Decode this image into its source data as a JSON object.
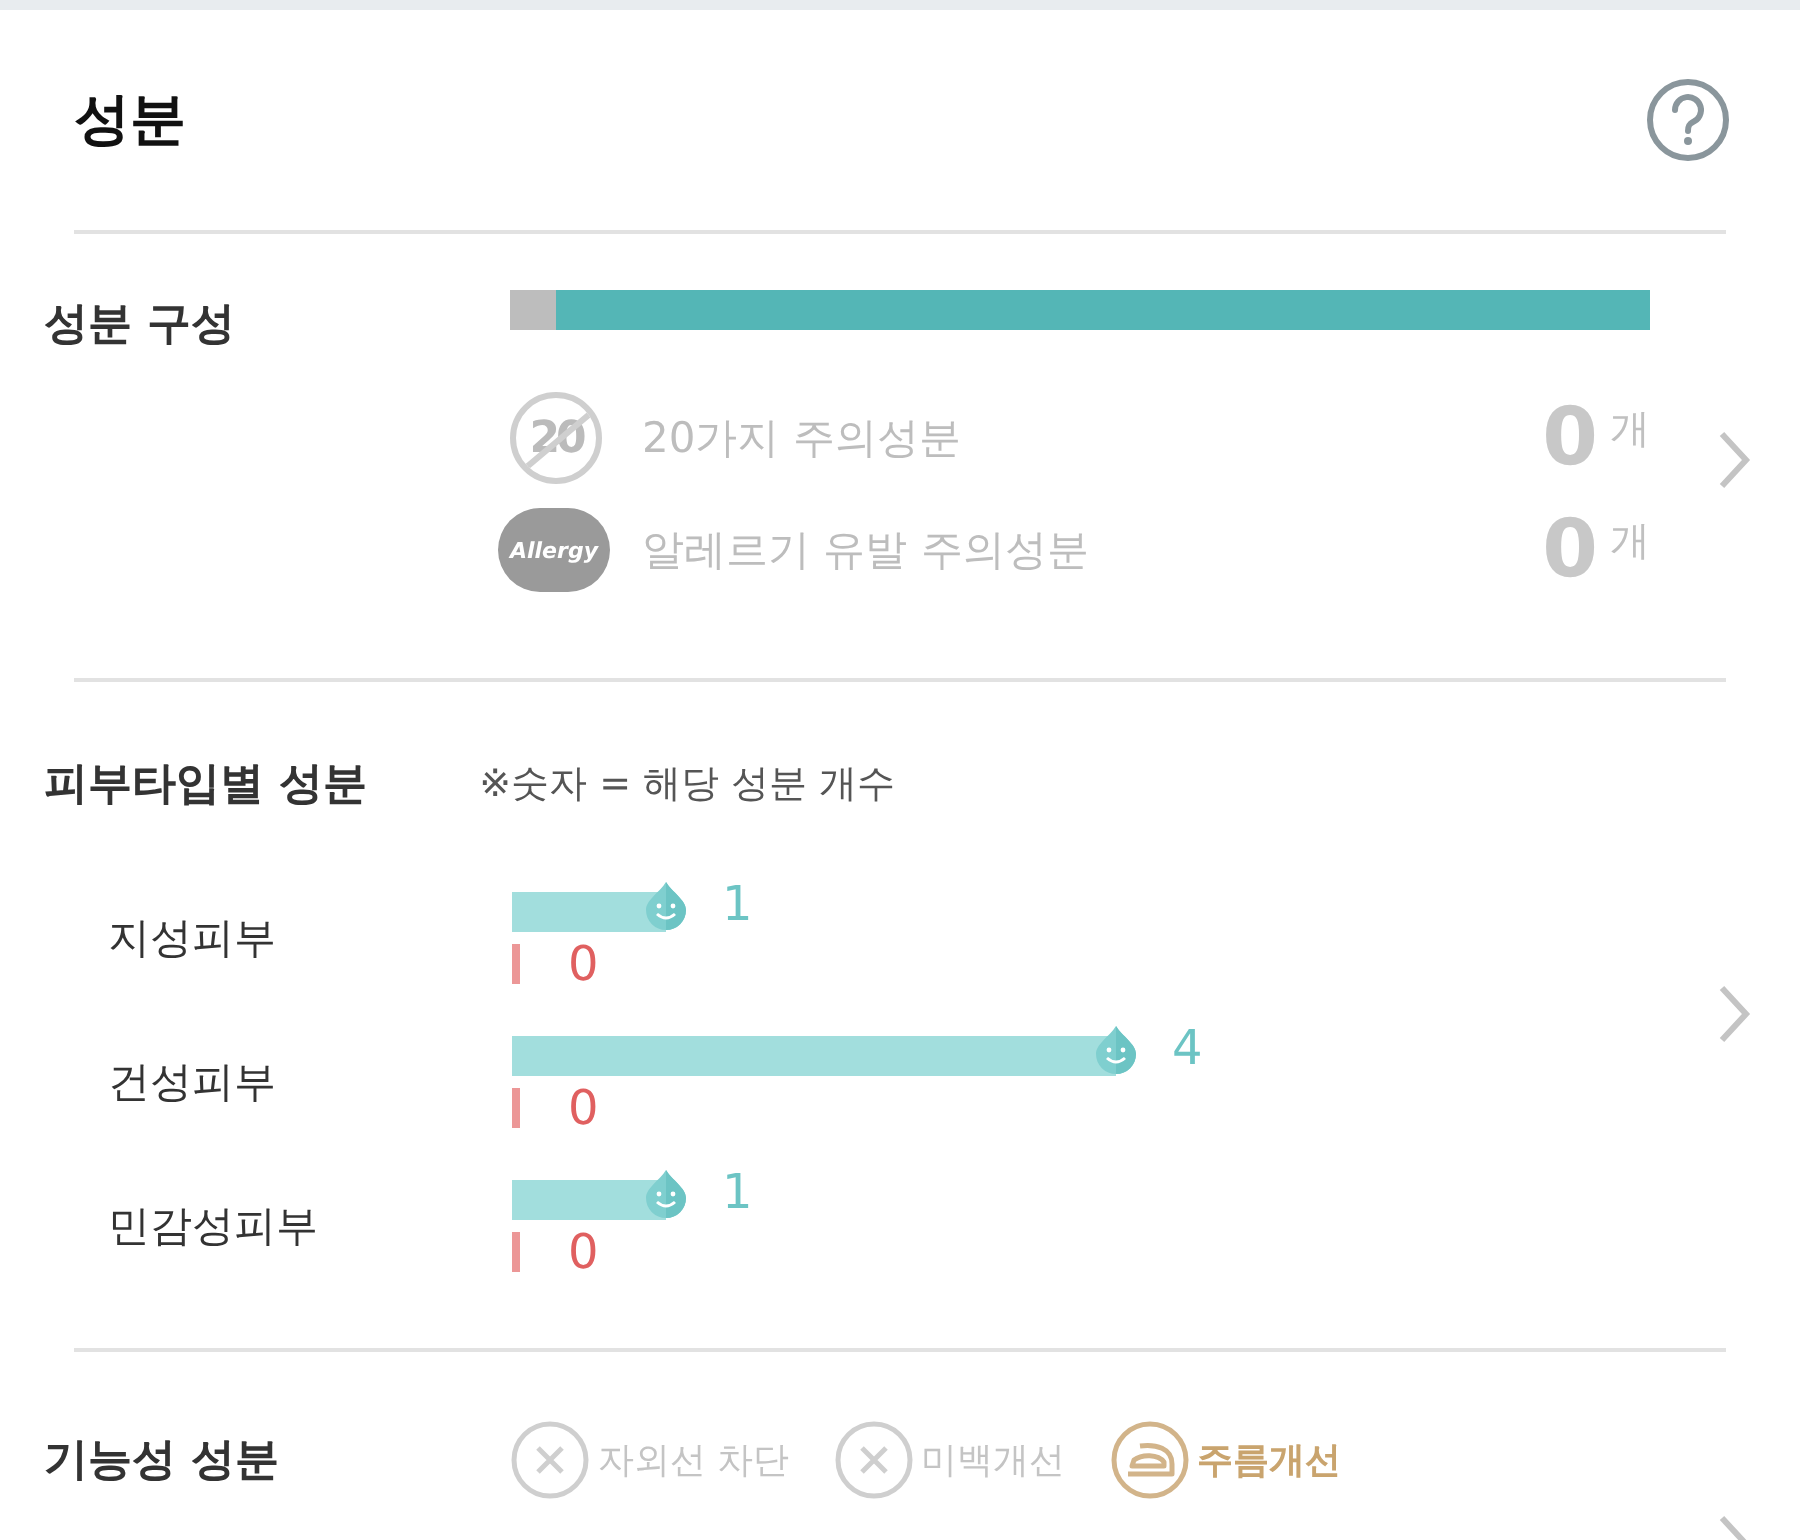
{
  "title": "성분",
  "composition": {
    "label": "성분 구성",
    "level": 0.96,
    "rows": [
      {
        "kind": "twenty",
        "icon_text": "20",
        "label": "20가지 주의성분",
        "count": "0",
        "unit": "개"
      },
      {
        "kind": "allergy",
        "icon_text": "Allergy",
        "label": "알레르기 유발 주의성분",
        "count": "0",
        "unit": "개"
      }
    ]
  },
  "skin_type": {
    "label": "피부타입별 성분",
    "note": "※숫자 = 해당 성분 개수",
    "rows": [
      {
        "label": "지성피부",
        "good": {
          "count": "1"
        },
        "bad": {
          "count": "0"
        }
      },
      {
        "label": "건성피부",
        "good": {
          "count": "4"
        },
        "bad": {
          "count": "0"
        }
      },
      {
        "label": "민감성피부",
        "good": {
          "count": "1"
        },
        "bad": {
          "count": "0"
        }
      }
    ]
  },
  "functional": {
    "label": "기능성 성분",
    "items": [
      {
        "label": "자외선 차단",
        "active": false
      },
      {
        "label": "미백개선",
        "active": false
      },
      {
        "label": "주름개선",
        "active": true
      }
    ]
  }
}
